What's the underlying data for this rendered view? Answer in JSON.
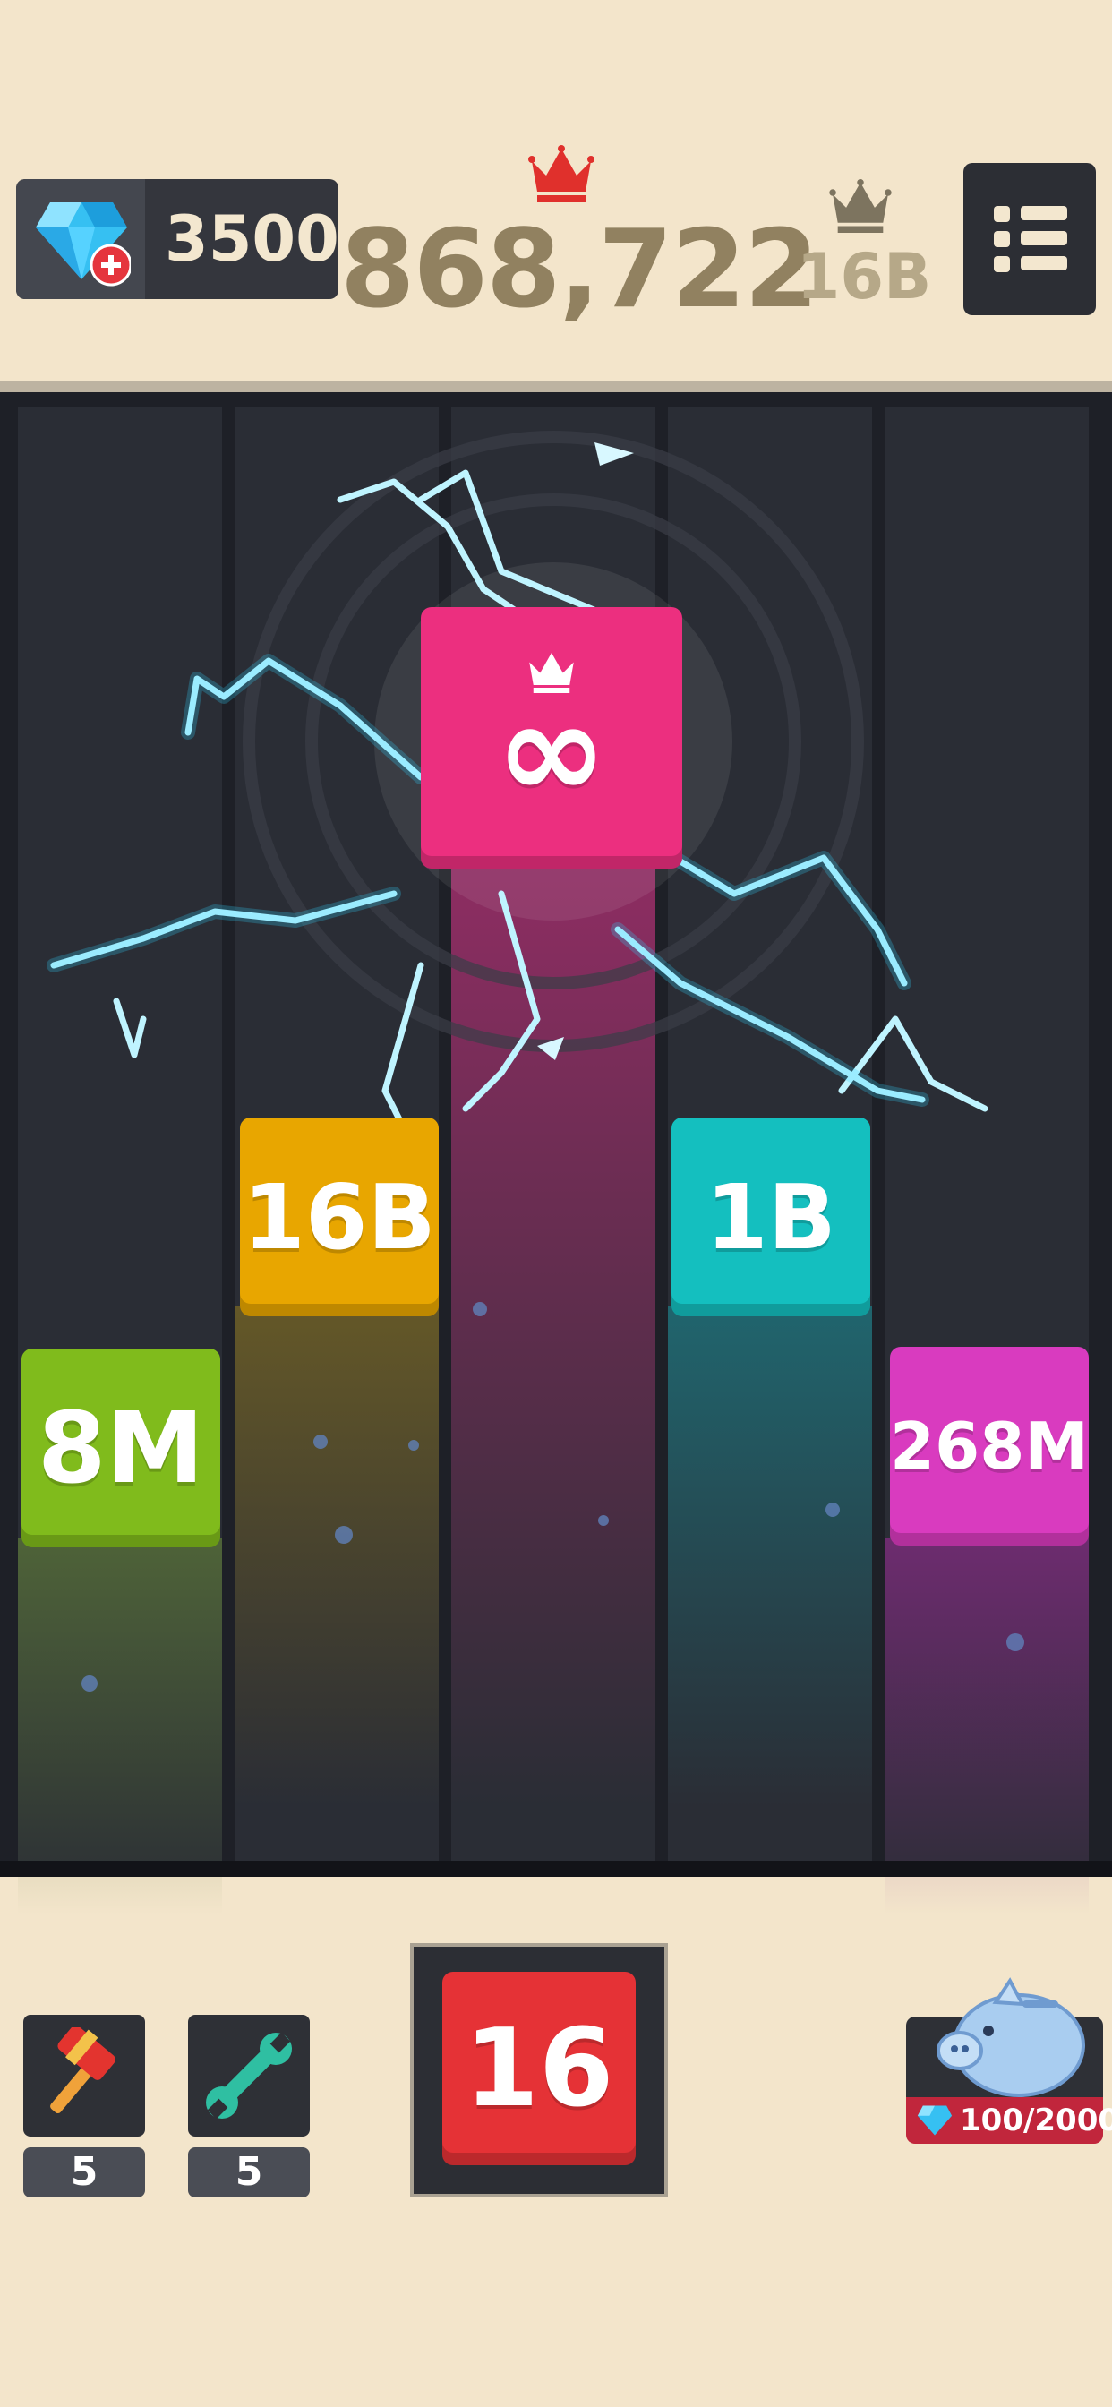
{
  "header": {
    "gem_count": "3500",
    "score": "868,722",
    "max_tile_label": "16B"
  },
  "board": {
    "tiles": [
      {
        "label": "∞",
        "color": "#ec2f7f",
        "column": 3
      },
      {
        "label": "16B",
        "color": "#e8a600",
        "column": 2
      },
      {
        "label": "1B",
        "color": "#14bfbf",
        "column": 4
      },
      {
        "label": "8M",
        "color": "#80bb1c",
        "column": 1
      },
      {
        "label": "268M",
        "color": "#d93bbf",
        "column": 5
      }
    ]
  },
  "next_tile": {
    "label": "16",
    "color": "#e53236"
  },
  "tools": {
    "hammer_count": "5",
    "wrench_count": "5"
  },
  "piggy_bank": {
    "progress_text": "100/2000"
  },
  "colors": {
    "background": "#f3e5cb",
    "board": "#1e2027",
    "accent_crown": "#e0302c"
  }
}
